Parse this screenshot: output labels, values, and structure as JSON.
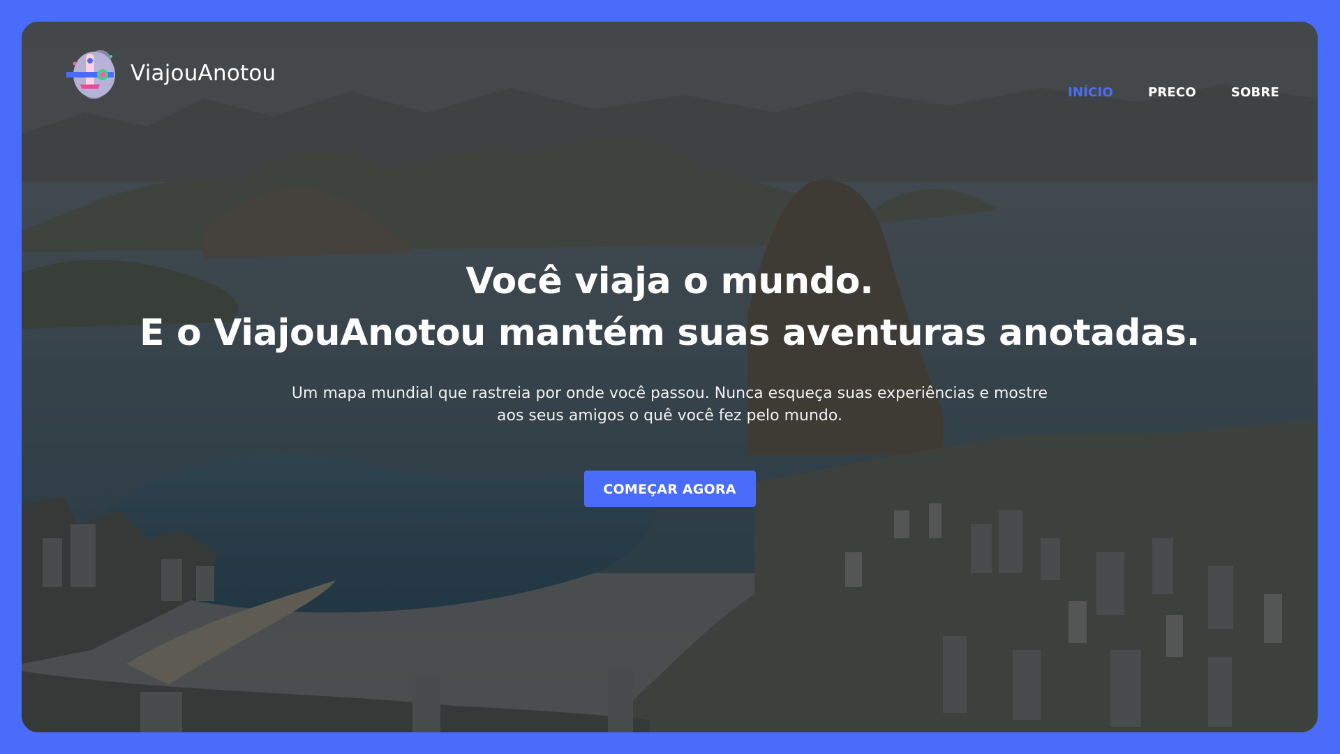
{
  "brand": {
    "name": "ViajouAnotou",
    "logo_icon": "airplane-icon"
  },
  "nav": {
    "items": [
      {
        "label": "INÍCIO",
        "active": true
      },
      {
        "label": "PRECO",
        "active": false
      },
      {
        "label": "SOBRE",
        "active": false
      }
    ]
  },
  "hero": {
    "headline_line1": "Você viaja o mundo.",
    "headline_line2": "E o ViajouAnotou mantém suas aventuras anotadas.",
    "subtitle": "Um mapa mundial que rastreia por onde você passou. Nunca esqueça suas experiências e mostre aos seus amigos o quê você fez pelo mundo.",
    "cta_label": "COMEÇAR AGORA"
  },
  "colors": {
    "accent": "#4a6cfa",
    "text": "#ffffff"
  }
}
